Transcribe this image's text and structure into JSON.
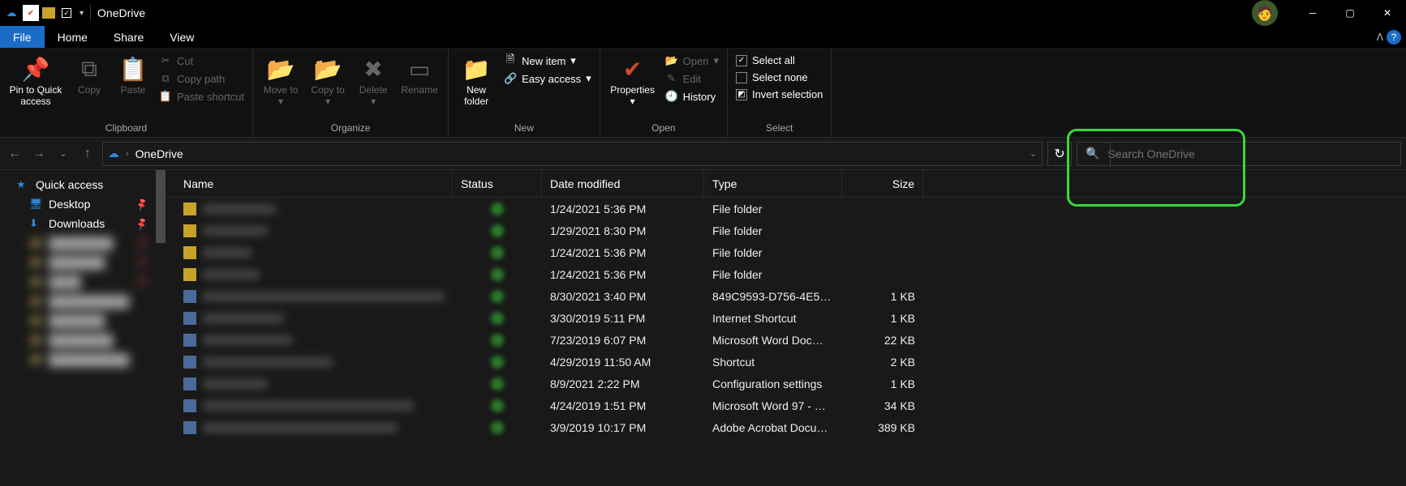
{
  "window": {
    "title": "OneDrive"
  },
  "tabs": {
    "file": "File",
    "home": "Home",
    "share": "Share",
    "view": "View"
  },
  "ribbon": {
    "clipboard": {
      "label": "Clipboard",
      "pin": "Pin to Quick access",
      "copy": "Copy",
      "paste": "Paste",
      "cut": "Cut",
      "copy_path": "Copy path",
      "paste_shortcut": "Paste shortcut"
    },
    "organize": {
      "label": "Organize",
      "move_to": "Move to",
      "copy_to": "Copy to",
      "delete": "Delete",
      "rename": "Rename"
    },
    "new": {
      "label": "New",
      "new_folder": "New folder",
      "new_item": "New item",
      "easy_access": "Easy access"
    },
    "open": {
      "label": "Open",
      "properties": "Properties",
      "open": "Open",
      "edit": "Edit",
      "history": "History"
    },
    "select": {
      "label": "Select",
      "select_all": "Select all",
      "select_none": "Select none",
      "invert": "Invert selection"
    }
  },
  "breadcrumb": {
    "location": "OneDrive"
  },
  "search": {
    "placeholder": "Search OneDrive"
  },
  "sidebar": {
    "quick_access": "Quick access",
    "desktop": "Desktop",
    "downloads": "Downloads"
  },
  "columns": {
    "name": "Name",
    "status": "Status",
    "date": "Date modified",
    "type": "Type",
    "size": "Size"
  },
  "rows": [
    {
      "date": "1/24/2021 5:36 PM",
      "type": "File folder",
      "size": "",
      "folder": true,
      "nw": 90
    },
    {
      "date": "1/29/2021 8:30 PM",
      "type": "File folder",
      "size": "",
      "folder": true,
      "nw": 80
    },
    {
      "date": "1/24/2021 5:36 PM",
      "type": "File folder",
      "size": "",
      "folder": true,
      "nw": 60
    },
    {
      "date": "1/24/2021 5:36 PM",
      "type": "File folder",
      "size": "",
      "folder": true,
      "nw": 70
    },
    {
      "date": "8/30/2021 3:40 PM",
      "type": "849C9593-D756-4E5…",
      "size": "1 KB",
      "folder": false,
      "nw": 300
    },
    {
      "date": "3/30/2019 5:11 PM",
      "type": "Internet Shortcut",
      "size": "1 KB",
      "folder": false,
      "nw": 100
    },
    {
      "date": "7/23/2019 6:07 PM",
      "type": "Microsoft Word Doc…",
      "size": "22 KB",
      "folder": false,
      "nw": 110
    },
    {
      "date": "4/29/2019 11:50 AM",
      "type": "Shortcut",
      "size": "2 KB",
      "folder": false,
      "nw": 160
    },
    {
      "date": "8/9/2021 2:22 PM",
      "type": "Configuration settings",
      "size": "1 KB",
      "folder": false,
      "nw": 80
    },
    {
      "date": "4/24/2019 1:51 PM",
      "type": "Microsoft Word 97 - …",
      "size": "34 KB",
      "folder": false,
      "nw": 260
    },
    {
      "date": "3/9/2019 10:17 PM",
      "type": "Adobe Acrobat Docu…",
      "size": "389 KB",
      "folder": false,
      "nw": 240
    }
  ]
}
